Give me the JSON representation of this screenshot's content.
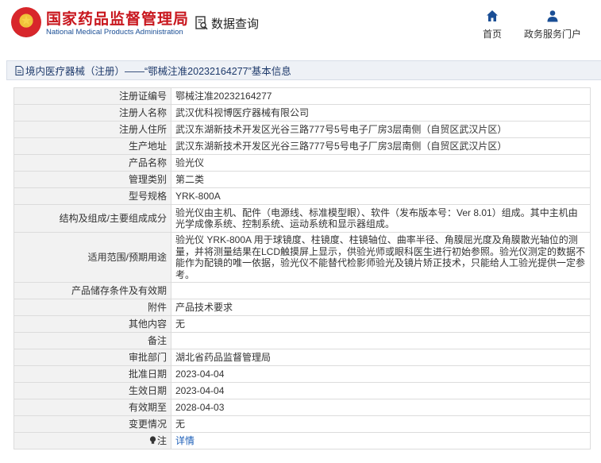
{
  "header": {
    "logo_cn": "国家药品监督管理局",
    "logo_en": "National Medical Products Administration",
    "query_label": "数据查询",
    "nav_home": "首页",
    "nav_portal": "政务服务门户"
  },
  "breadcrumb": "境内医疗器械（注册）——“鄂械注准20232164277”基本信息",
  "rows": [
    {
      "label": "注册证编号",
      "value": "鄂械注准20232164277"
    },
    {
      "label": "注册人名称",
      "value": "武汉优科视博医疗器械有限公司"
    },
    {
      "label": "注册人住所",
      "value": "武汉东湖新技术开发区光谷三路777号5号电子厂房3层南侧（自贸区武汉片区）"
    },
    {
      "label": "生产地址",
      "value": "武汉东湖新技术开发区光谷三路777号5号电子厂房3层南侧（自贸区武汉片区）"
    },
    {
      "label": "产品名称",
      "value": "验光仪"
    },
    {
      "label": "管理类别",
      "value": "第二类"
    },
    {
      "label": "型号规格",
      "value": "YRK-800A"
    },
    {
      "label": "结构及组成/主要组成成分",
      "value": "验光仪由主机、配件（电源线、标准模型眼）、软件（发布版本号：Ver 8.01）组成。其中主机由光学成像系统、控制系统、运动系统和显示器组成。"
    },
    {
      "label": "适用范围/预期用途",
      "value": "验光仪 YRK-800A 用于球镜度、柱镜度、柱镜轴位、曲率半径、角膜屈光度及角膜散光轴位的测量，并将测量结果在LCD触摸屏上显示，供验光师或眼科医生进行初始参照。验光仪测定的数据不能作为配镜的唯一依据，验光仪不能替代检影师验光及镜片矫正技术，只能给人工验光提供一定参考。"
    },
    {
      "label": "产品储存条件及有效期",
      "value": ""
    },
    {
      "label": "附件",
      "value": "产品技术要求"
    },
    {
      "label": "其他内容",
      "value": "无"
    },
    {
      "label": "备注",
      "value": ""
    },
    {
      "label": "审批部门",
      "value": "湖北省药品监督管理局"
    },
    {
      "label": "批准日期",
      "value": "2023-04-04"
    },
    {
      "label": "生效日期",
      "value": "2023-04-04"
    },
    {
      "label": "有效期至",
      "value": "2028-04-03"
    },
    {
      "label": "变更情况",
      "value": "无"
    },
    {
      "label": "注",
      "value": "详情"
    }
  ],
  "colors": {
    "brand_red": "#c8161d",
    "brand_blue": "#1a4e95",
    "link_blue": "#1d5fb8",
    "label_bg": "#f2f2f2"
  }
}
